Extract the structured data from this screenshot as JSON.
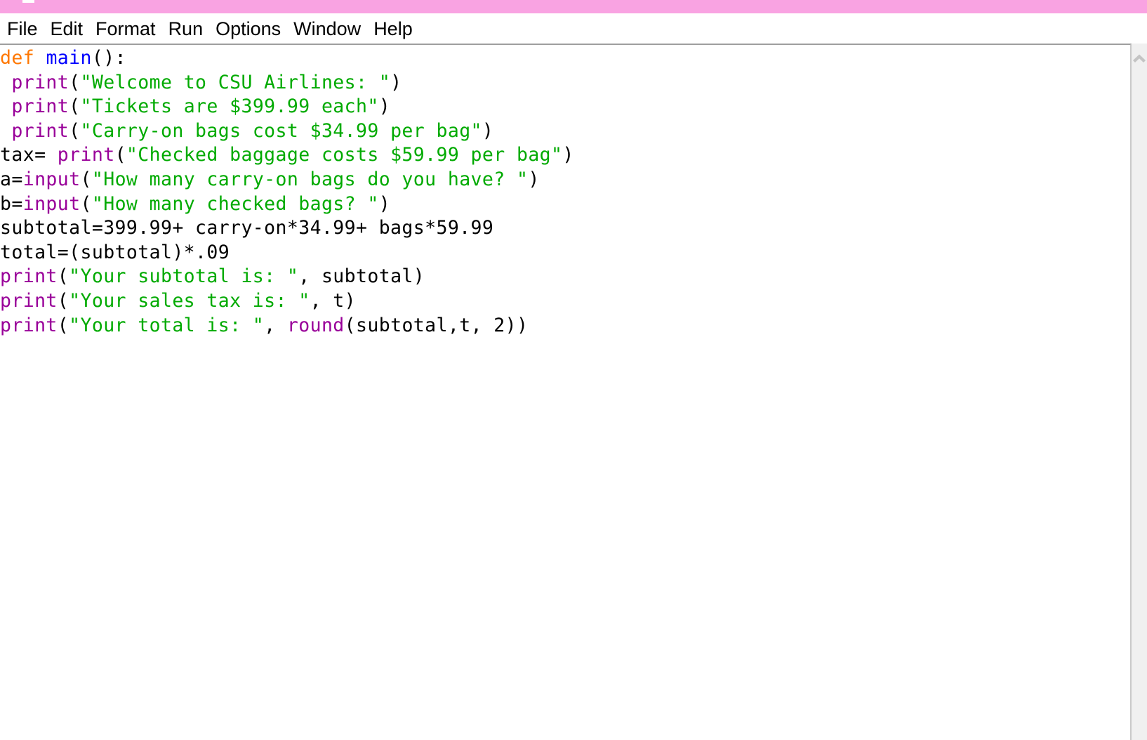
{
  "window": {
    "titlebar_color": "#f9a3e2",
    "title": ""
  },
  "menubar": {
    "items": [
      {
        "label": "File",
        "name": "menu-file"
      },
      {
        "label": "Edit",
        "name": "menu-edit"
      },
      {
        "label": "Format",
        "name": "menu-format"
      },
      {
        "label": "Run",
        "name": "menu-run"
      },
      {
        "label": "Options",
        "name": "menu-options"
      },
      {
        "label": "Window",
        "name": "menu-window"
      },
      {
        "label": "Help",
        "name": "menu-help"
      }
    ]
  },
  "editor": {
    "language": "python",
    "syntax_colors": {
      "keyword": "#ff7700",
      "definition": "#0000ff",
      "builtin": "#990099",
      "string": "#00aa00",
      "plain": "#000000"
    },
    "lines": [
      [
        {
          "t": "def",
          "c": "kw"
        },
        {
          "t": " ",
          "c": "pl"
        },
        {
          "t": "main",
          "c": "fnd"
        },
        {
          "t": "():",
          "c": "pl"
        }
      ],
      [
        {
          "t": " ",
          "c": "pl"
        },
        {
          "t": "print",
          "c": "bi"
        },
        {
          "t": "(",
          "c": "pl"
        },
        {
          "t": "\"Welcome to CSU Airlines: \"",
          "c": "str"
        },
        {
          "t": ")",
          "c": "pl"
        }
      ],
      [
        {
          "t": " ",
          "c": "pl"
        },
        {
          "t": "print",
          "c": "bi"
        },
        {
          "t": "(",
          "c": "pl"
        },
        {
          "t": "\"Tickets are $399.99 each\"",
          "c": "str"
        },
        {
          "t": ")",
          "c": "pl"
        }
      ],
      [
        {
          "t": " ",
          "c": "pl"
        },
        {
          "t": "print",
          "c": "bi"
        },
        {
          "t": "(",
          "c": "pl"
        },
        {
          "t": "\"Carry-on bags cost $34.99 per bag\"",
          "c": "str"
        },
        {
          "t": ")",
          "c": "pl"
        }
      ],
      [
        {
          "t": "tax= ",
          "c": "pl"
        },
        {
          "t": "print",
          "c": "bi"
        },
        {
          "t": "(",
          "c": "pl"
        },
        {
          "t": "\"Checked baggage costs $59.99 per bag\"",
          "c": "str"
        },
        {
          "t": ")",
          "c": "pl"
        }
      ],
      [
        {
          "t": "a=",
          "c": "pl"
        },
        {
          "t": "input",
          "c": "bi"
        },
        {
          "t": "(",
          "c": "pl"
        },
        {
          "t": "\"How many carry-on bags do you have? \"",
          "c": "str"
        },
        {
          "t": ")",
          "c": "pl"
        }
      ],
      [
        {
          "t": "b=",
          "c": "pl"
        },
        {
          "t": "input",
          "c": "bi"
        },
        {
          "t": "(",
          "c": "pl"
        },
        {
          "t": "\"How many checked bags? \"",
          "c": "str"
        },
        {
          "t": ")",
          "c": "pl"
        }
      ],
      [
        {
          "t": "subtotal=399.99+ carry-on*34.99+ bags*59.99",
          "c": "pl"
        }
      ],
      [
        {
          "t": "total=(subtotal)*.09",
          "c": "pl"
        }
      ],
      [
        {
          "t": "print",
          "c": "bi"
        },
        {
          "t": "(",
          "c": "pl"
        },
        {
          "t": "\"Your subtotal is: \"",
          "c": "str"
        },
        {
          "t": ", subtotal)",
          "c": "pl"
        }
      ],
      [
        {
          "t": "print",
          "c": "bi"
        },
        {
          "t": "(",
          "c": "pl"
        },
        {
          "t": "\"Your sales tax is: \"",
          "c": "str"
        },
        {
          "t": ", t)",
          "c": "pl"
        }
      ],
      [
        {
          "t": "print",
          "c": "bi"
        },
        {
          "t": "(",
          "c": "pl"
        },
        {
          "t": "\"Your total is: \"",
          "c": "str"
        },
        {
          "t": ", ",
          "c": "pl"
        },
        {
          "t": "round",
          "c": "bi"
        },
        {
          "t": "(subtotal,t, 2))",
          "c": "pl"
        }
      ]
    ],
    "plain_text": "def main():\n print(\"Welcome to CSU Airlines: \")\n print(\"Tickets are $399.99 each\")\n print(\"Carry-on bags cost $34.99 per bag\")\ntax= print(\"Checked baggage costs $59.99 per bag\")\na=input(\"How many carry-on bags do you have? \")\nb=input(\"How many checked bags? \")\nsubtotal=399.99+ carry-on*34.99+ bags*59.99\ntotal=(subtotal)*.09\nprint(\"Your subtotal is: \", subtotal)\nprint(\"Your sales tax is: \", t)\nprint(\"Your total is: \", round(subtotal,t, 2))"
  },
  "scrollbar": {
    "orientation": "vertical",
    "arrow_up_icon": "chevron-up-icon",
    "track_color": "#f0f0f0",
    "arrow_color": "#c4c4c4"
  }
}
